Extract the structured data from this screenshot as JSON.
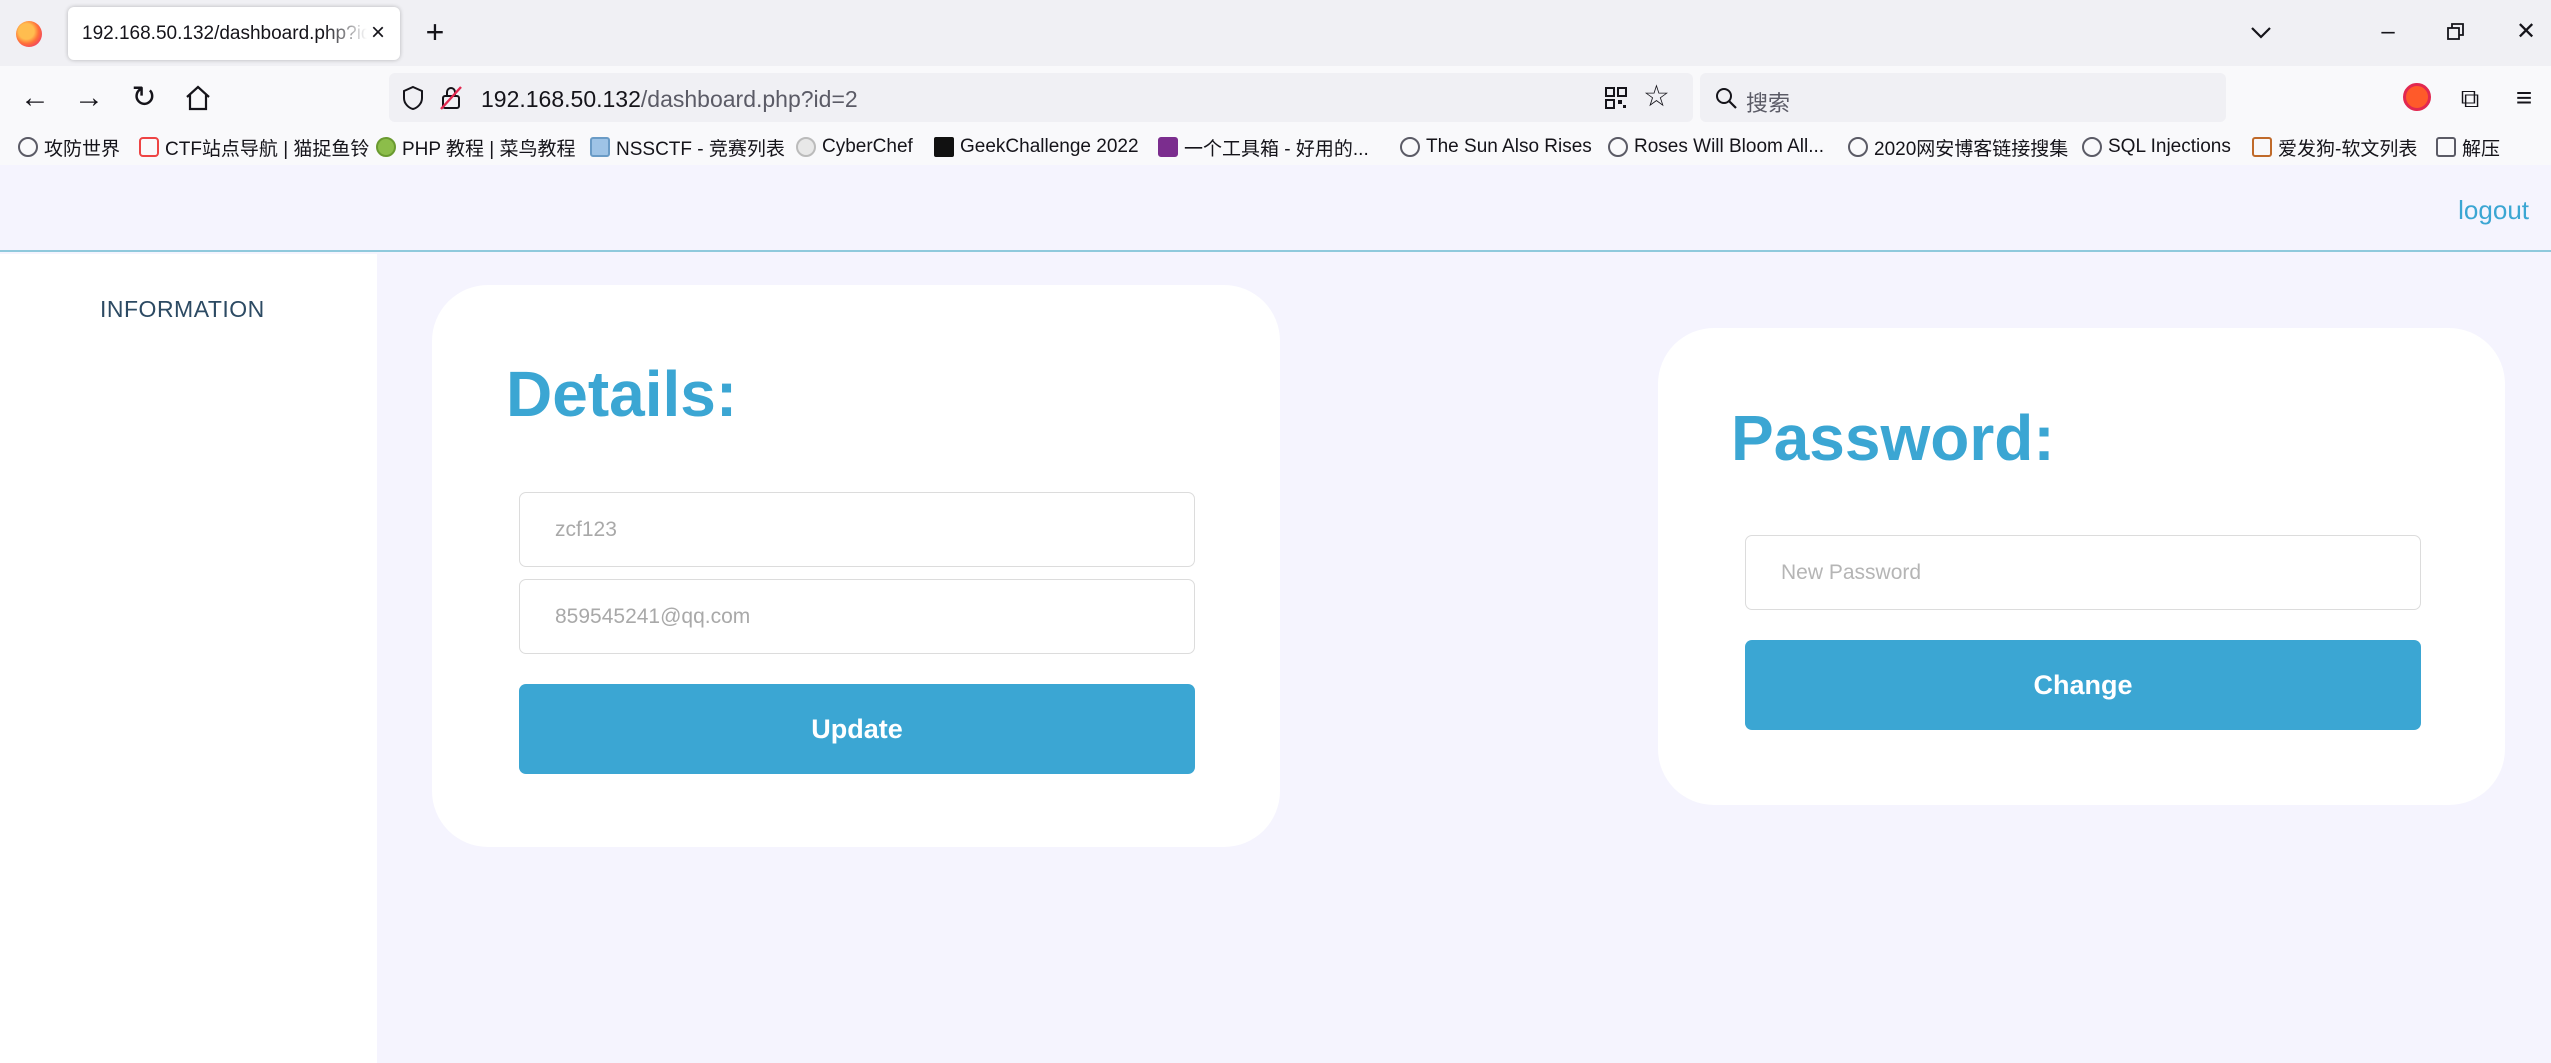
{
  "browser": {
    "tab_title": "192.168.50.132/dashboard.php?id=2",
    "url_host": "192.168.50.132",
    "url_path": "/dashboard.php?id=2",
    "search_placeholder": "搜索",
    "bookmarks": [
      {
        "label": "攻防世界",
        "icon": "globe-icon"
      },
      {
        "label": "CTF站点导航 | 猫捉鱼铃",
        "icon": "site-favicon"
      },
      {
        "label": "PHP 教程 | 菜鸟教程",
        "icon": "runoob-favicon"
      },
      {
        "label": "NSSCTF - 竞赛列表",
        "icon": "nssctf-favicon"
      },
      {
        "label": "CyberChef",
        "icon": "cyberchef-favicon"
      },
      {
        "label": "GeekChallenge 2022",
        "icon": "geek-favicon"
      },
      {
        "label": "一个工具箱 - 好用的...",
        "icon": "toolbox-favicon"
      },
      {
        "label": "The Sun Also Rises",
        "icon": "globe-icon"
      },
      {
        "label": "Roses Will Bloom All...",
        "icon": "globe-icon"
      },
      {
        "label": "2020网安博客链接搜集",
        "icon": "globe-icon"
      },
      {
        "label": "SQL Injections",
        "icon": "globe-icon"
      },
      {
        "label": "爱发狗-软文列表",
        "icon": "site-favicon"
      },
      {
        "label": "解压",
        "icon": "folder-icon"
      }
    ]
  },
  "page": {
    "logout_label": "logout",
    "sidebar_item": "INFORMATION",
    "details": {
      "title": "Details:",
      "username_value": "zcf123",
      "email_value": "859545241@qq.com",
      "update_label": "Update"
    },
    "password": {
      "title": "Password:",
      "new_password_placeholder": "New Password",
      "change_label": "Change"
    }
  },
  "colors": {
    "accent": "#3ba6d3",
    "page_bg": "#f5f4fe",
    "card_bg": "#ffffff"
  }
}
